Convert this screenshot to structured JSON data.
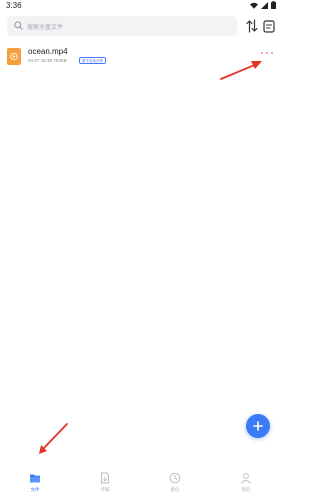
{
  "status_bar": {
    "time": "3:36",
    "icons": [
      "wifi-icon",
      "signal-icon",
      "battery-icon"
    ]
  },
  "search": {
    "placeholder": "搜索全盘文件"
  },
  "toolbar": {
    "icons": [
      "sort-icon",
      "filter-icon"
    ]
  },
  "files": [
    {
      "name": "ocean.mp4",
      "meta": "04-07 15:35 753KB",
      "tag": "暂不支持分享",
      "icon": "video-file-icon"
    }
  ],
  "bottom_nav": {
    "items": [
      {
        "label": "文件",
        "icon": "folder-icon",
        "active": true
      },
      {
        "label": "传输",
        "icon": "transfer-icon",
        "active": false
      },
      {
        "label": "备份",
        "icon": "backup-icon",
        "active": false
      },
      {
        "label": "我的",
        "icon": "user-icon",
        "active": false
      }
    ]
  },
  "colors": {
    "accent": "#3b7cf6",
    "file_icon": "#f59f3d",
    "annotation_arrow": "#e5312a"
  }
}
